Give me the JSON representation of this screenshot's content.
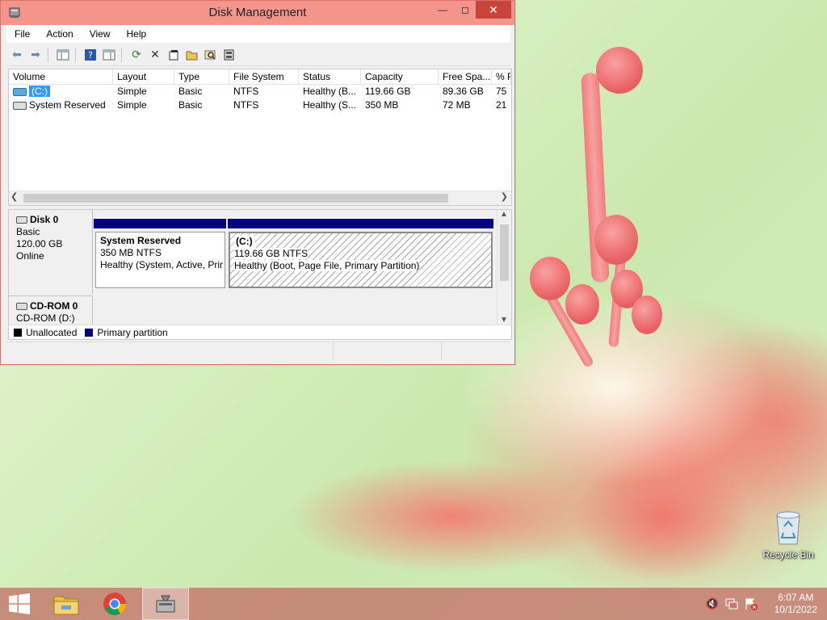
{
  "window": {
    "title": "Disk Management",
    "menu": [
      "File",
      "Action",
      "View",
      "Help"
    ]
  },
  "volumes": {
    "columns": [
      "Volume",
      "Layout",
      "Type",
      "File System",
      "Status",
      "Capacity",
      "Free Spa...",
      "% F"
    ],
    "rows": [
      {
        "volume": "(C:)",
        "layout": "Simple",
        "type": "Basic",
        "fs": "NTFS",
        "status": "Healthy (B...",
        "capacity": "119.66 GB",
        "free": "89.36 GB",
        "pct": "75"
      },
      {
        "volume": "System Reserved",
        "layout": "Simple",
        "type": "Basic",
        "fs": "NTFS",
        "status": "Healthy (S...",
        "capacity": "350 MB",
        "free": "72 MB",
        "pct": "21"
      }
    ]
  },
  "disks": {
    "disk0": {
      "name": "Disk 0",
      "type": "Basic",
      "size": "120.00 GB",
      "state": "Online",
      "partitions": [
        {
          "name": "System Reserved",
          "size": "350 MB NTFS",
          "status": "Healthy (System, Active, Prir"
        },
        {
          "name": "(C:)",
          "size": "119.66 GB NTFS",
          "status": "Healthy (Boot, Page File, Primary Partition)"
        }
      ]
    },
    "cdrom0": {
      "name": "CD-ROM 0",
      "drive": "CD-ROM (D:)"
    }
  },
  "legend": {
    "unallocated": "Unallocated",
    "primary": "Primary partition",
    "unallocated_color": "#000000",
    "primary_color": "#000080"
  },
  "desktop": {
    "recycle_bin": "Recycle Bin"
  },
  "taskbar": {
    "time": "6:07 AM",
    "date": "10/1/2022"
  }
}
